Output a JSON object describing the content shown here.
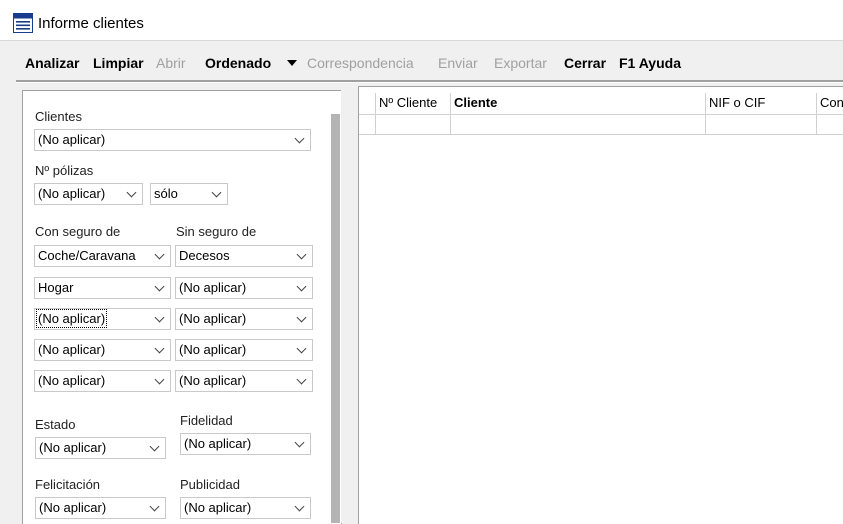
{
  "window": {
    "title": "Informe clientes",
    "icon": "report-app-icon"
  },
  "toolbar": {
    "analizar": "Analizar",
    "limpiar": "Limpiar",
    "abrir": "Abrir",
    "ordenado": "Ordenado",
    "correspondencia": "Correspondencia",
    "enviar": "Enviar",
    "exportar": "Exportar",
    "cerrar": "Cerrar",
    "ayuda": "F1 Ayuda"
  },
  "filters": {
    "clientes": {
      "label": "Clientes",
      "value": "(No aplicar)"
    },
    "polizas": {
      "label": "Nº pólizas",
      "value": "(No aplicar)",
      "modifier": "sólo"
    },
    "con_seguro": {
      "label": "Con seguro de",
      "values": [
        "Coche/Caravana",
        "Hogar",
        "(No aplicar)",
        "(No aplicar)",
        "(No aplicar)"
      ]
    },
    "sin_seguro": {
      "label": "Sin seguro de",
      "values": [
        "Decesos",
        "(No aplicar)",
        "(No aplicar)",
        "(No aplicar)",
        "(No aplicar)"
      ]
    },
    "estado": {
      "label": "Estado",
      "value": "(No aplicar)"
    },
    "fidelidad": {
      "label": "Fidelidad",
      "value": "(No aplicar)"
    },
    "felicitacion": {
      "label": "Felicitación",
      "value": "(No aplicar)"
    },
    "publicidad": {
      "label": "Publicidad",
      "value": "(No aplicar)"
    }
  },
  "grid": {
    "columns": [
      "Nº Cliente",
      "Cliente",
      "NIF o CIF",
      "Con"
    ]
  }
}
